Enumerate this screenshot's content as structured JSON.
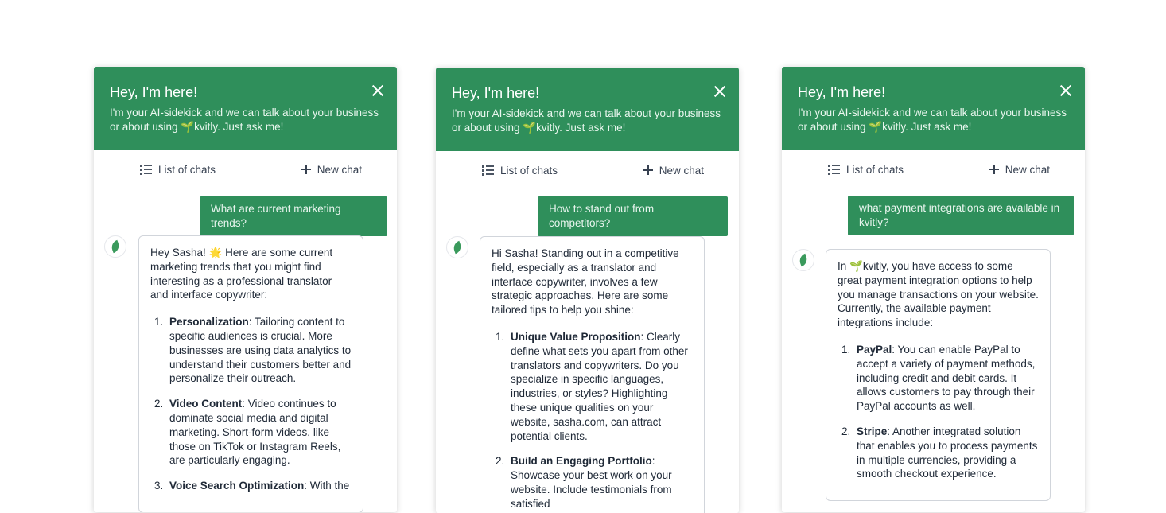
{
  "panels": [
    {
      "title": "Hey, I'm here!",
      "subtitle": "I'm your AI-sidekick and we can talk about your business or about using 🌱kvitly. Just ask me!",
      "tab_list": "List of chats",
      "tab_new": "New chat",
      "question": "What are current marketing trends?",
      "intro": "Hey Sasha! 🌟 Here are some current marketing trends that you might find interesting as a professional translator and interface copywriter:",
      "items": [
        {
          "num": "1.",
          "title": "Personalization",
          "text": ": Tailoring content to specific audiences is crucial. More businesses are using data analytics to understand their customers better and personalize their outreach."
        },
        {
          "num": "2.",
          "title": "Video Content",
          "text": ": Video continues to dominate social media and digital marketing. Short-form videos, like those on TikTok or Instagram Reels, are particularly engaging."
        },
        {
          "num": "3.",
          "title": "Voice Search Optimization",
          "text": ": With the"
        }
      ]
    },
    {
      "title": "Hey, I'm here!",
      "subtitle": "I'm your AI-sidekick and we can talk about your business or about using 🌱kvitly. Just ask me!",
      "tab_list": "List of chats",
      "tab_new": "New chat",
      "question": "How to stand out from competitors?",
      "intro": "Hi Sasha! Standing out in a competitive field, especially as a translator and interface copywriter, involves a few strategic approaches. Here are some tailored tips to help you shine:",
      "items": [
        {
          "num": "1.",
          "title": "Unique Value Proposition",
          "text": ": Clearly define what sets you apart from other translators and copywriters. Do you specialize in specific languages, industries, or styles? Highlighting these unique qualities on your website, sasha.com, can attract potential clients."
        },
        {
          "num": "2.",
          "title": "Build an Engaging Portfolio",
          "text": ": Showcase your best work on your website. Include testimonials from satisfied"
        }
      ]
    },
    {
      "title": "Hey, I'm here!",
      "subtitle": "I'm your AI-sidekick and we can talk about your business or about using 🌱kvitly. Just ask me!",
      "tab_list": "List of chats",
      "tab_new": "New chat",
      "question": "what payment integrations are available in kvitly?",
      "intro": "In 🌱kvitly, you have access to some great payment integration options to help you manage transactions on your website. Currently, the available payment integrations include:",
      "items": [
        {
          "num": "1.",
          "title": "PayPal",
          "text": ": You can enable PayPal to accept a variety of payment methods, including credit and debit cards. It allows customers to pay through their PayPal accounts as well."
        },
        {
          "num": "2.",
          "title": "Stripe",
          "text": ": Another integrated solution that enables you to process payments in multiple currencies, providing a smooth checkout experience."
        }
      ]
    }
  ],
  "colors": {
    "brand": "#2f8f5b",
    "border": "#d1d5db"
  },
  "icons": {
    "close": "close-icon",
    "list": "list-icon",
    "plus": "plus-icon",
    "avatar": "leaf-icon"
  }
}
